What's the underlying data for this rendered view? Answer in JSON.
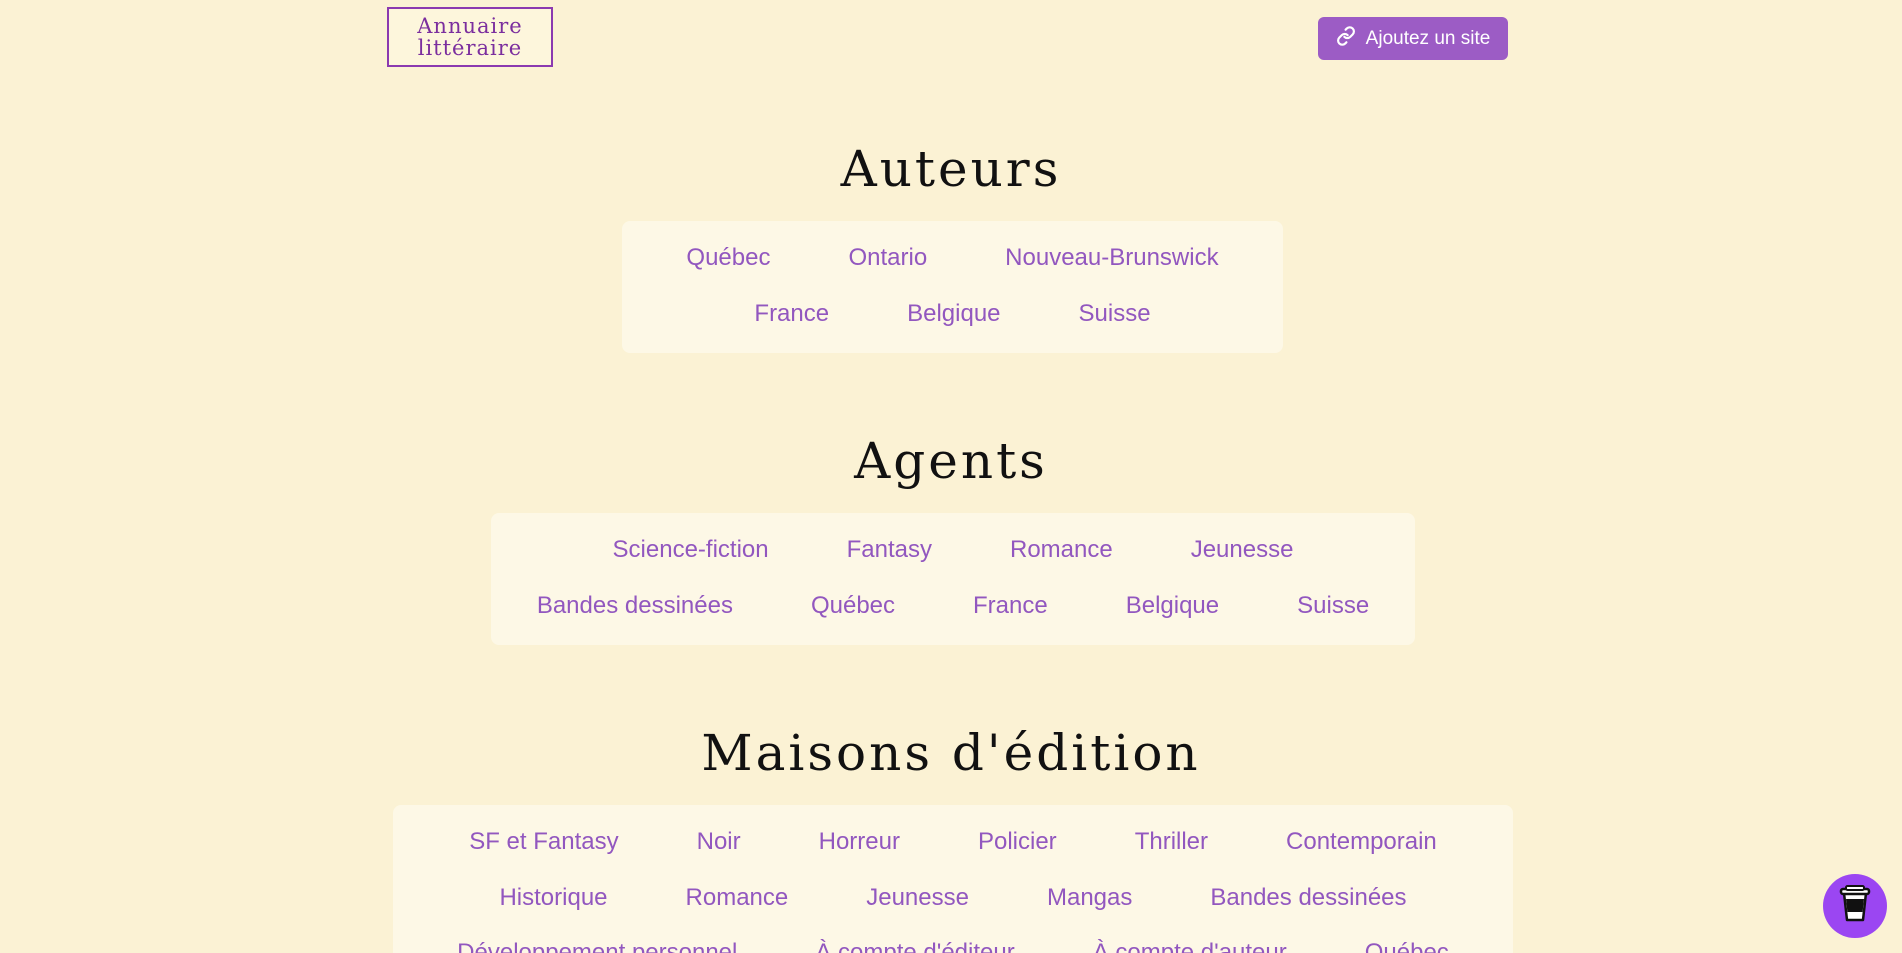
{
  "header": {
    "logo_line1": "Annuaire",
    "logo_line2": "littéraire",
    "add_site_label": "Ajoutez un site"
  },
  "sections": {
    "auteurs": {
      "title": "Auteurs",
      "rows": [
        [
          "Québec",
          "Ontario",
          "Nouveau-Brunswick"
        ],
        [
          "France",
          "Belgique",
          "Suisse"
        ]
      ]
    },
    "agents": {
      "title": "Agents",
      "rows": [
        [
          "Science-fiction",
          "Fantasy",
          "Romance",
          "Jeunesse"
        ],
        [
          "Bandes dessinées",
          "Québec",
          "France",
          "Belgique",
          "Suisse"
        ]
      ]
    },
    "maisons": {
      "title": "Maisons d'édition",
      "rows": [
        [
          "SF et Fantasy",
          "Noir",
          "Horreur",
          "Policier",
          "Thriller",
          "Contemporain"
        ],
        [
          "Historique",
          "Romance",
          "Jeunesse",
          "Mangas",
          "Bandes dessinées"
        ],
        [
          "Développement personnel",
          "À compte d'éditeur",
          "À compte d'auteur",
          "Québec"
        ]
      ]
    }
  },
  "icons": {
    "add_site": "link-icon",
    "fab": "coffee-cup-icon"
  },
  "colors": {
    "background": "#fbf2d4",
    "accent": "#9257bf",
    "button": "#9c5cc5",
    "fab": "#9b46f2"
  }
}
